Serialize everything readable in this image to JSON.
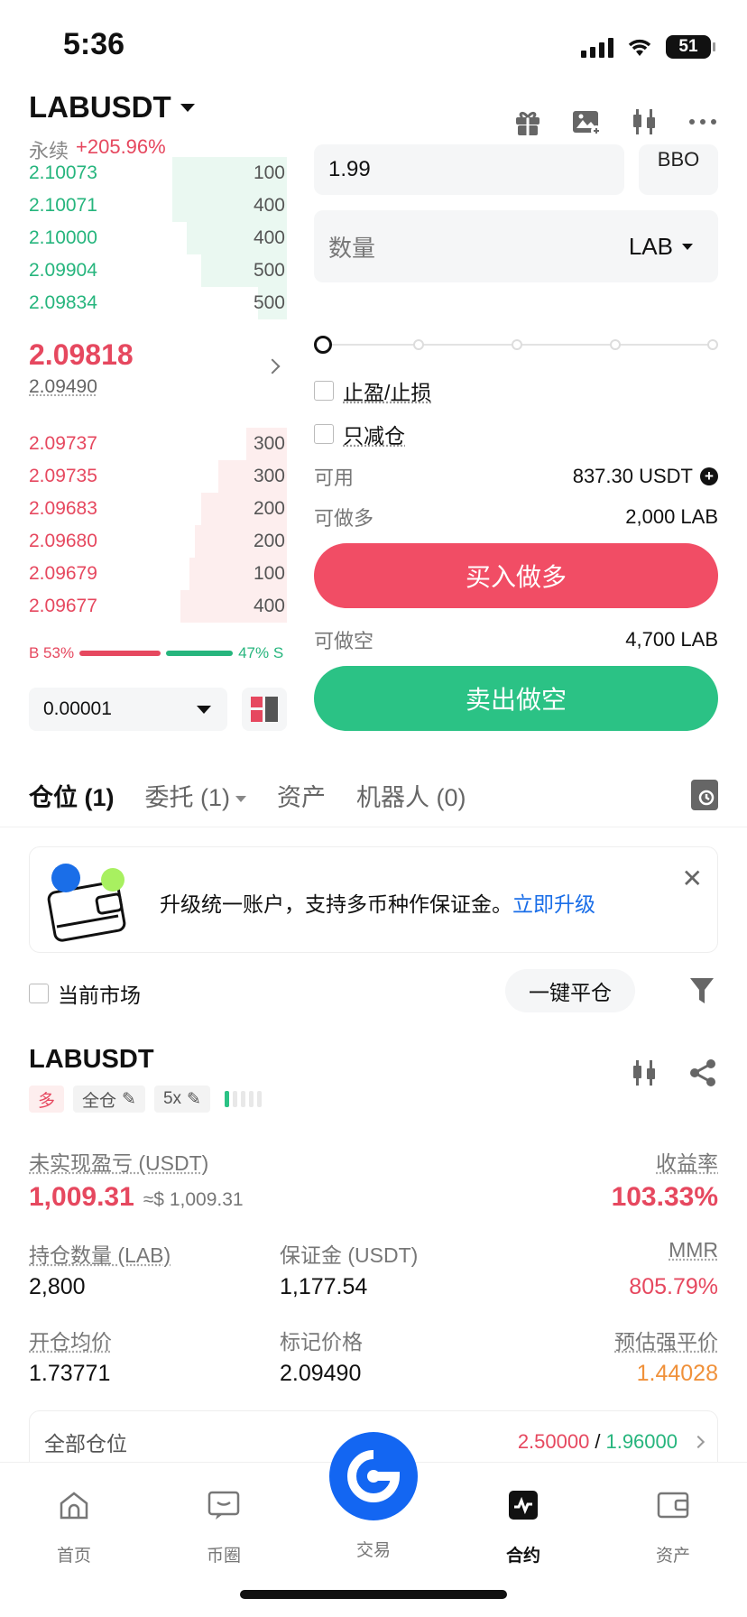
{
  "status": {
    "time": "5:36",
    "battery": "51"
  },
  "header": {
    "symbol": "LABUSDT",
    "type": "永续",
    "change": "+205.96%"
  },
  "orderbook": {
    "bids": [
      {
        "price": "2.10073",
        "qty": "100",
        "depth": 0.4
      },
      {
        "price": "2.10071",
        "qty": "400",
        "depth": 0.4
      },
      {
        "price": "2.10000",
        "qty": "400",
        "depth": 0.35
      },
      {
        "price": "2.09904",
        "qty": "500",
        "depth": 0.3
      },
      {
        "price": "2.09834",
        "qty": "500",
        "depth": 0.1
      }
    ],
    "mid_price": "2.09818",
    "mark_price": "2.09490",
    "asks": [
      {
        "price": "2.09737",
        "qty": "300",
        "depth": 0.14
      },
      {
        "price": "2.09735",
        "qty": "300",
        "depth": 0.24
      },
      {
        "price": "2.09683",
        "qty": "200",
        "depth": 0.3
      },
      {
        "price": "2.09680",
        "qty": "200",
        "depth": 0.32
      },
      {
        "price": "2.09679",
        "qty": "100",
        "depth": 0.34
      },
      {
        "price": "2.09677",
        "qty": "400",
        "depth": 0.37
      }
    ],
    "buy_ratio": "B 53%",
    "sell_ratio": "47% S",
    "tick_size": "0.00001"
  },
  "order_form": {
    "price_value": "1.99",
    "bbo_label": "BBO",
    "qty_placeholder": "数量",
    "qty_unit": "LAB",
    "tp_sl_label": "止盈/止损",
    "reduce_only_label": "只减仓",
    "available_label": "可用",
    "available_value": "837.30 USDT",
    "can_long_label": "可做多",
    "can_long_value": "2,000 LAB",
    "buy_button": "买入做多",
    "can_short_label": "可做空",
    "can_short_value": "4,700 LAB",
    "sell_button": "卖出做空"
  },
  "tabs": {
    "positions": "仓位 (1)",
    "orders": "委托 (1)",
    "assets": "资产",
    "bots": "机器人 (0)"
  },
  "banner": {
    "text": "升级统一账户，支持多币种作保证金。",
    "link": "立即升级"
  },
  "filters": {
    "current_market": "当前市场",
    "close_all": "一键平仓"
  },
  "position": {
    "symbol": "LABUSDT",
    "side": "多",
    "margin_mode": "全仓",
    "leverage": "5x",
    "unrealized_pnl_label": "未实现盈亏 (USDT)",
    "unrealized_pnl": "1,009.31",
    "unrealized_pnl_usd": "≈$ 1,009.31",
    "roi_label": "收益率",
    "roi": "103.33%",
    "size_label": "持仓数量 (LAB)",
    "size": "2,800",
    "margin_label": "保证金 (USDT)",
    "margin": "1,177.54",
    "mmr_label": "MMR",
    "mmr": "805.79%",
    "entry_label": "开仓均价",
    "entry": "1.73771",
    "mark_label": "标记价格",
    "mark": "2.09490",
    "liq_label": "预估强平价",
    "liq": "1.44028",
    "all_positions_label": "全部仓位",
    "tp_price": "2.50000",
    "separator": " / ",
    "sl_price": "1.96000"
  },
  "nav": {
    "home": "首页",
    "circle": "币圈",
    "trade": "交易",
    "futures": "合约",
    "assets": "资产"
  },
  "colors": {
    "red": "#e6485f",
    "green": "#26b57d",
    "blue": "#1366f2",
    "orange": "#f0913a"
  }
}
